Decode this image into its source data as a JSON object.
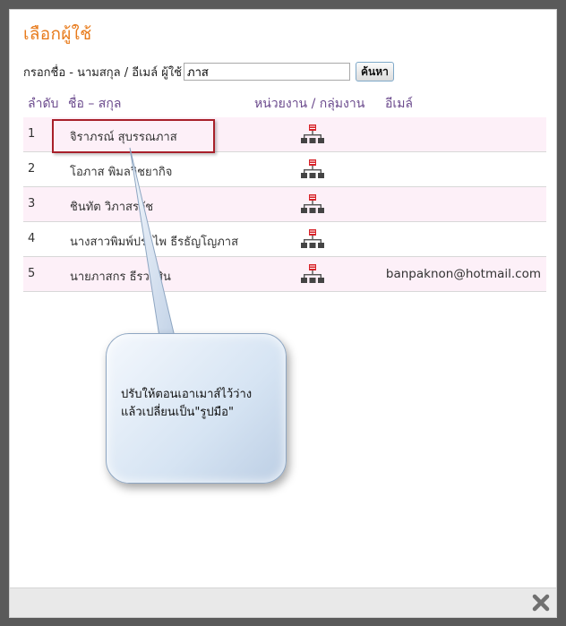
{
  "dialog": {
    "title": "เลือกผู้ใช้"
  },
  "search": {
    "label": "กรอกชื่อ - นามสกุล / อีเมล์ ผู้ใช้",
    "value": "ภาส",
    "button_label": "ค้นหา"
  },
  "table": {
    "headers": {
      "order": "ลำดับ",
      "name": "ชื่อ – สกุล",
      "org": "หน่วยงาน / กลุ่มงาน",
      "email": "อีเมล์"
    },
    "rows": [
      {
        "order": "1",
        "name": "จิราภรณ์ สุบรรณภาส",
        "org_icon": "org-chart-icon",
        "email": ""
      },
      {
        "order": "2",
        "name": "โอภาส พิมลวิชยากิจ",
        "org_icon": "org-chart-icon",
        "email": ""
      },
      {
        "order": "3",
        "name": "ชินทัต วิภาสรวัช",
        "org_icon": "org-chart-icon",
        "email": ""
      },
      {
        "order": "4",
        "name": "นางสาวพิมพ์ประไพ ธีรธัญโญภาส",
        "org_icon": "org-chart-icon",
        "email": ""
      },
      {
        "order": "5",
        "name": "นายภาสกร ธีรวาสิน",
        "org_icon": "org-chart-icon",
        "email": "banpaknon@hotmail.com"
      }
    ]
  },
  "callout": {
    "text": "ปรับให้ตอนเอาเมาส์ไว้ว่าง\nแล้วเปลี่ยนเป็น\"รูปมือ\""
  },
  "colors": {
    "title": "#e87b1c",
    "header_text": "#6b4a8d",
    "row_alt": "#fdf0f8",
    "highlight_border": "#a8202a",
    "org_icon_red": "#d8232a"
  },
  "footer": {
    "close_icon": "close-icon"
  }
}
